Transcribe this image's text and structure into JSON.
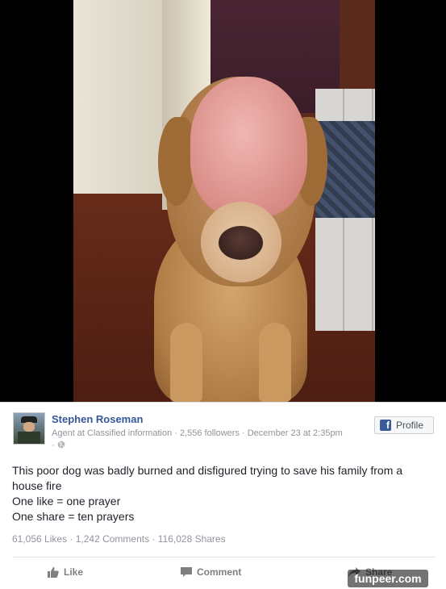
{
  "post": {
    "author": "Stephen Roseman",
    "meta": "Agent at Classified information · 2,556 followers · December 23 at 2:35pm",
    "meta_privacy": "· ",
    "profile_button": "Profile",
    "text_lines": [
      "This poor dog was badly burned and disfigured trying to save his family from a",
      "house fire",
      "One like = one prayer",
      "One share = ten prayers"
    ],
    "stats": "61,056 Likes · 1,242 Comments · 116,028 Shares",
    "actions": {
      "like": "Like",
      "comment": "Comment",
      "share": "Share"
    }
  },
  "watermark": "funpeer.com",
  "colors": {
    "author_link": "#365899",
    "meta_gray": "#90949c",
    "facebook_blue": "#3b5998",
    "photo_letterbox": "#000000"
  },
  "icons": {
    "profile": "facebook-logo-icon",
    "privacy": "globe-icon",
    "like": "thumbs-up-icon",
    "comment": "speech-bubble-icon",
    "share": "share-arrow-icon"
  }
}
